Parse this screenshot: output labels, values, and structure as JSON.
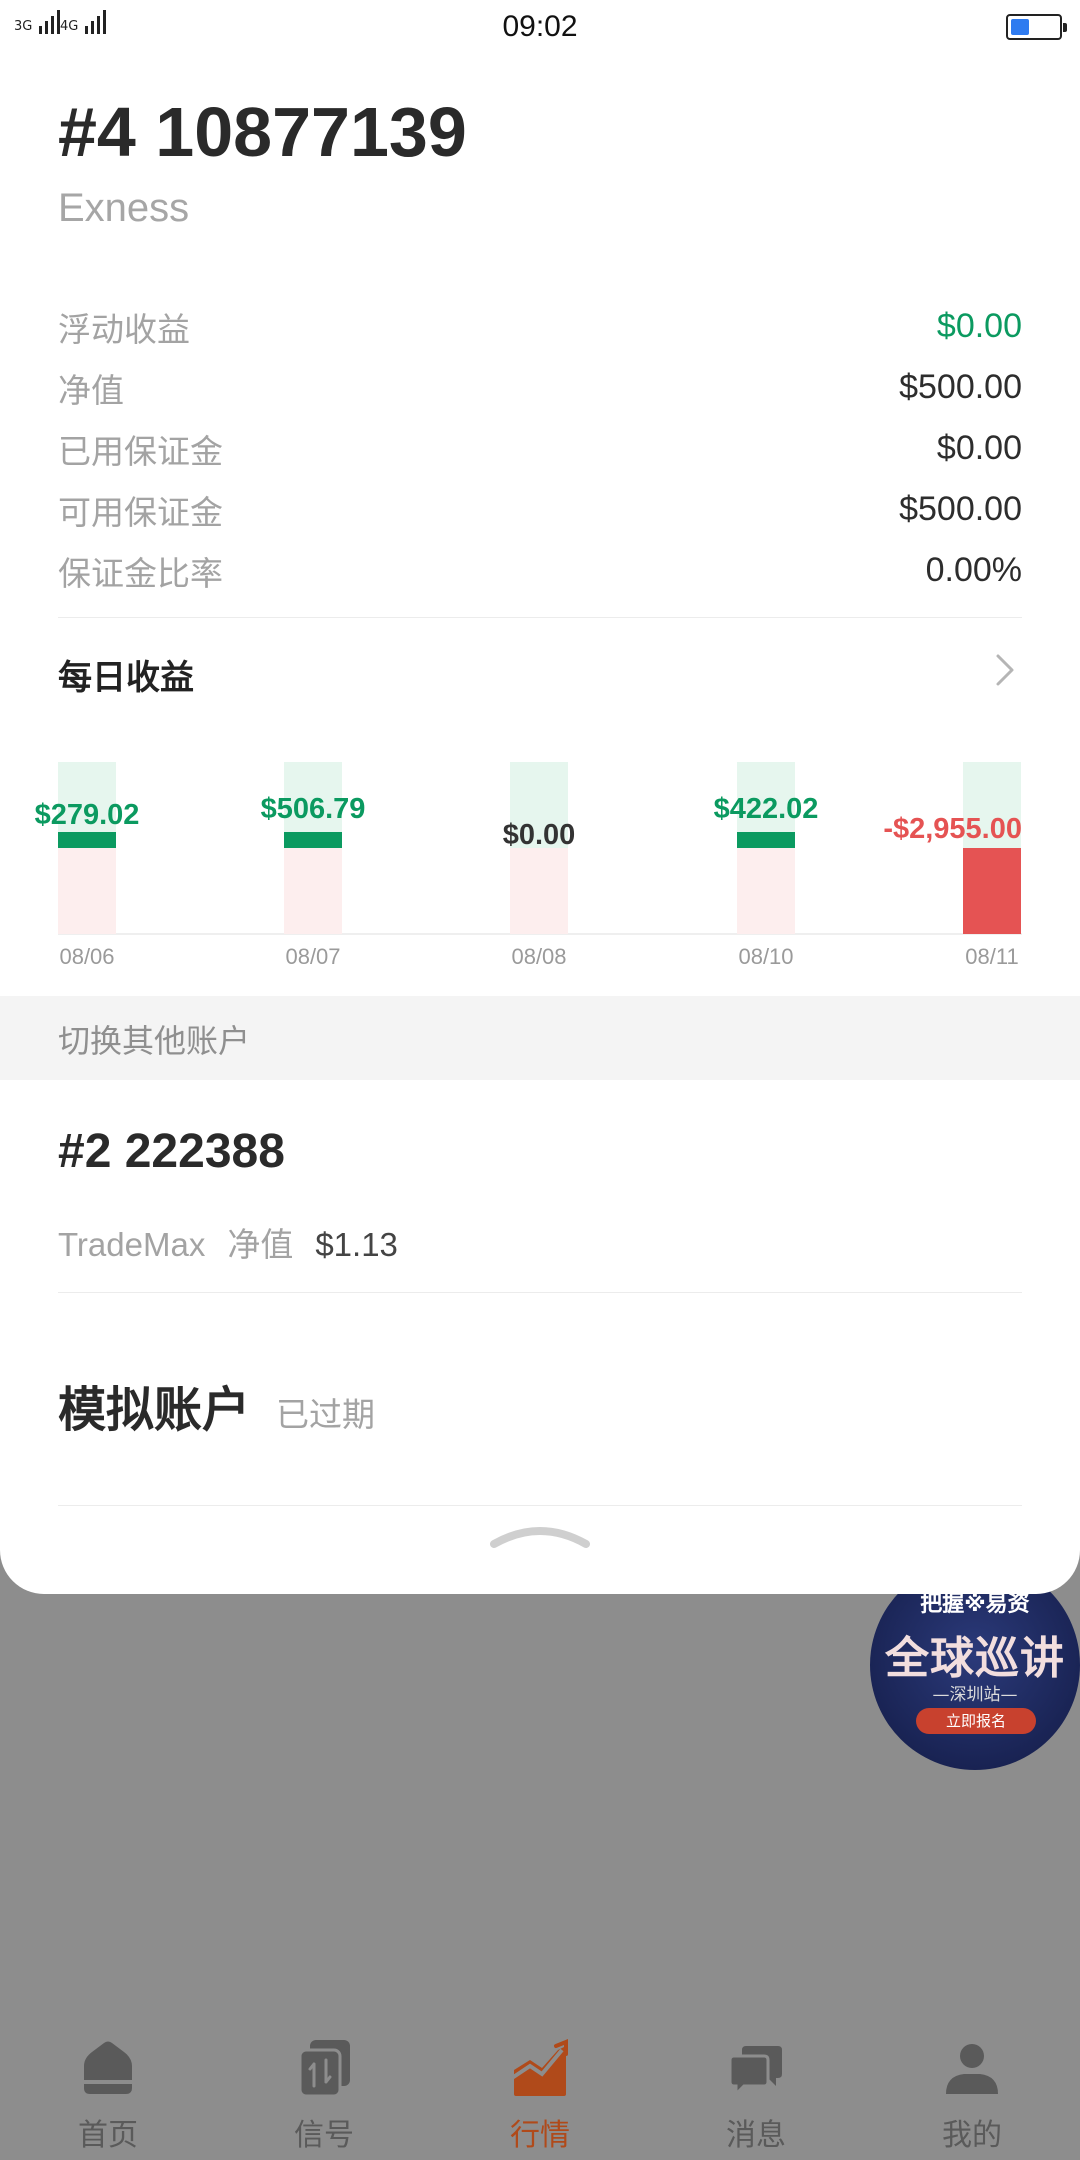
{
  "status_bar": {
    "signal_1": "3G",
    "signal_2": "4G",
    "time": "09:02",
    "battery_level": 0.35
  },
  "account": {
    "id": "#4 10877139",
    "broker": "Exness",
    "stats": [
      {
        "label": "浮动收益",
        "value": "$0.00",
        "positive": true
      },
      {
        "label": "净值",
        "value": "$500.00",
        "positive": false
      },
      {
        "label": "已用保证金",
        "value": "$0.00",
        "positive": false
      },
      {
        "label": "可用保证金",
        "value": "$500.00",
        "positive": false
      },
      {
        "label": "保证金比率",
        "value": "0.00%",
        "positive": false
      }
    ]
  },
  "daily_earnings": {
    "title": "每日收益",
    "colors": {
      "positive": "#0b9a60",
      "negative": "#e55353",
      "zero": "#333333",
      "positive_bg": "#e6f6ee",
      "negative_bg": "#fdeeee"
    }
  },
  "chart_data": {
    "type": "bar",
    "categories": [
      "08/06",
      "08/07",
      "08/08",
      "08/10",
      "08/11"
    ],
    "values": [
      279.02,
      506.79,
      0.0,
      422.02,
      -2955.0
    ],
    "labels": [
      "$279.02",
      "$506.79",
      "$0.00",
      "$422.02",
      "-$2,955.00"
    ]
  },
  "switch_section": {
    "label": "切换其他账户"
  },
  "other_account": {
    "id": "#2 222388",
    "broker": "TradeMax",
    "equity_label": "净值",
    "equity_value": "$1.13"
  },
  "demo_account": {
    "title": "模拟账户",
    "status": "已过期"
  },
  "promo": {
    "top_text": "把握※易资",
    "main_text": "全球巡讲",
    "sub_text": "—深圳站—",
    "button_text": "立即报名"
  },
  "bottom_nav": {
    "items": [
      {
        "label": "首页",
        "icon": "home-icon"
      },
      {
        "label": "信号",
        "icon": "signal-cards-icon"
      },
      {
        "label": "行情",
        "icon": "market-chart-icon",
        "active": true
      },
      {
        "label": "消息",
        "icon": "message-bubbles-icon"
      },
      {
        "label": "我的",
        "icon": "profile-icon"
      }
    ],
    "active_color": "#b04a1a",
    "inactive_color": "#5a5a5a"
  }
}
